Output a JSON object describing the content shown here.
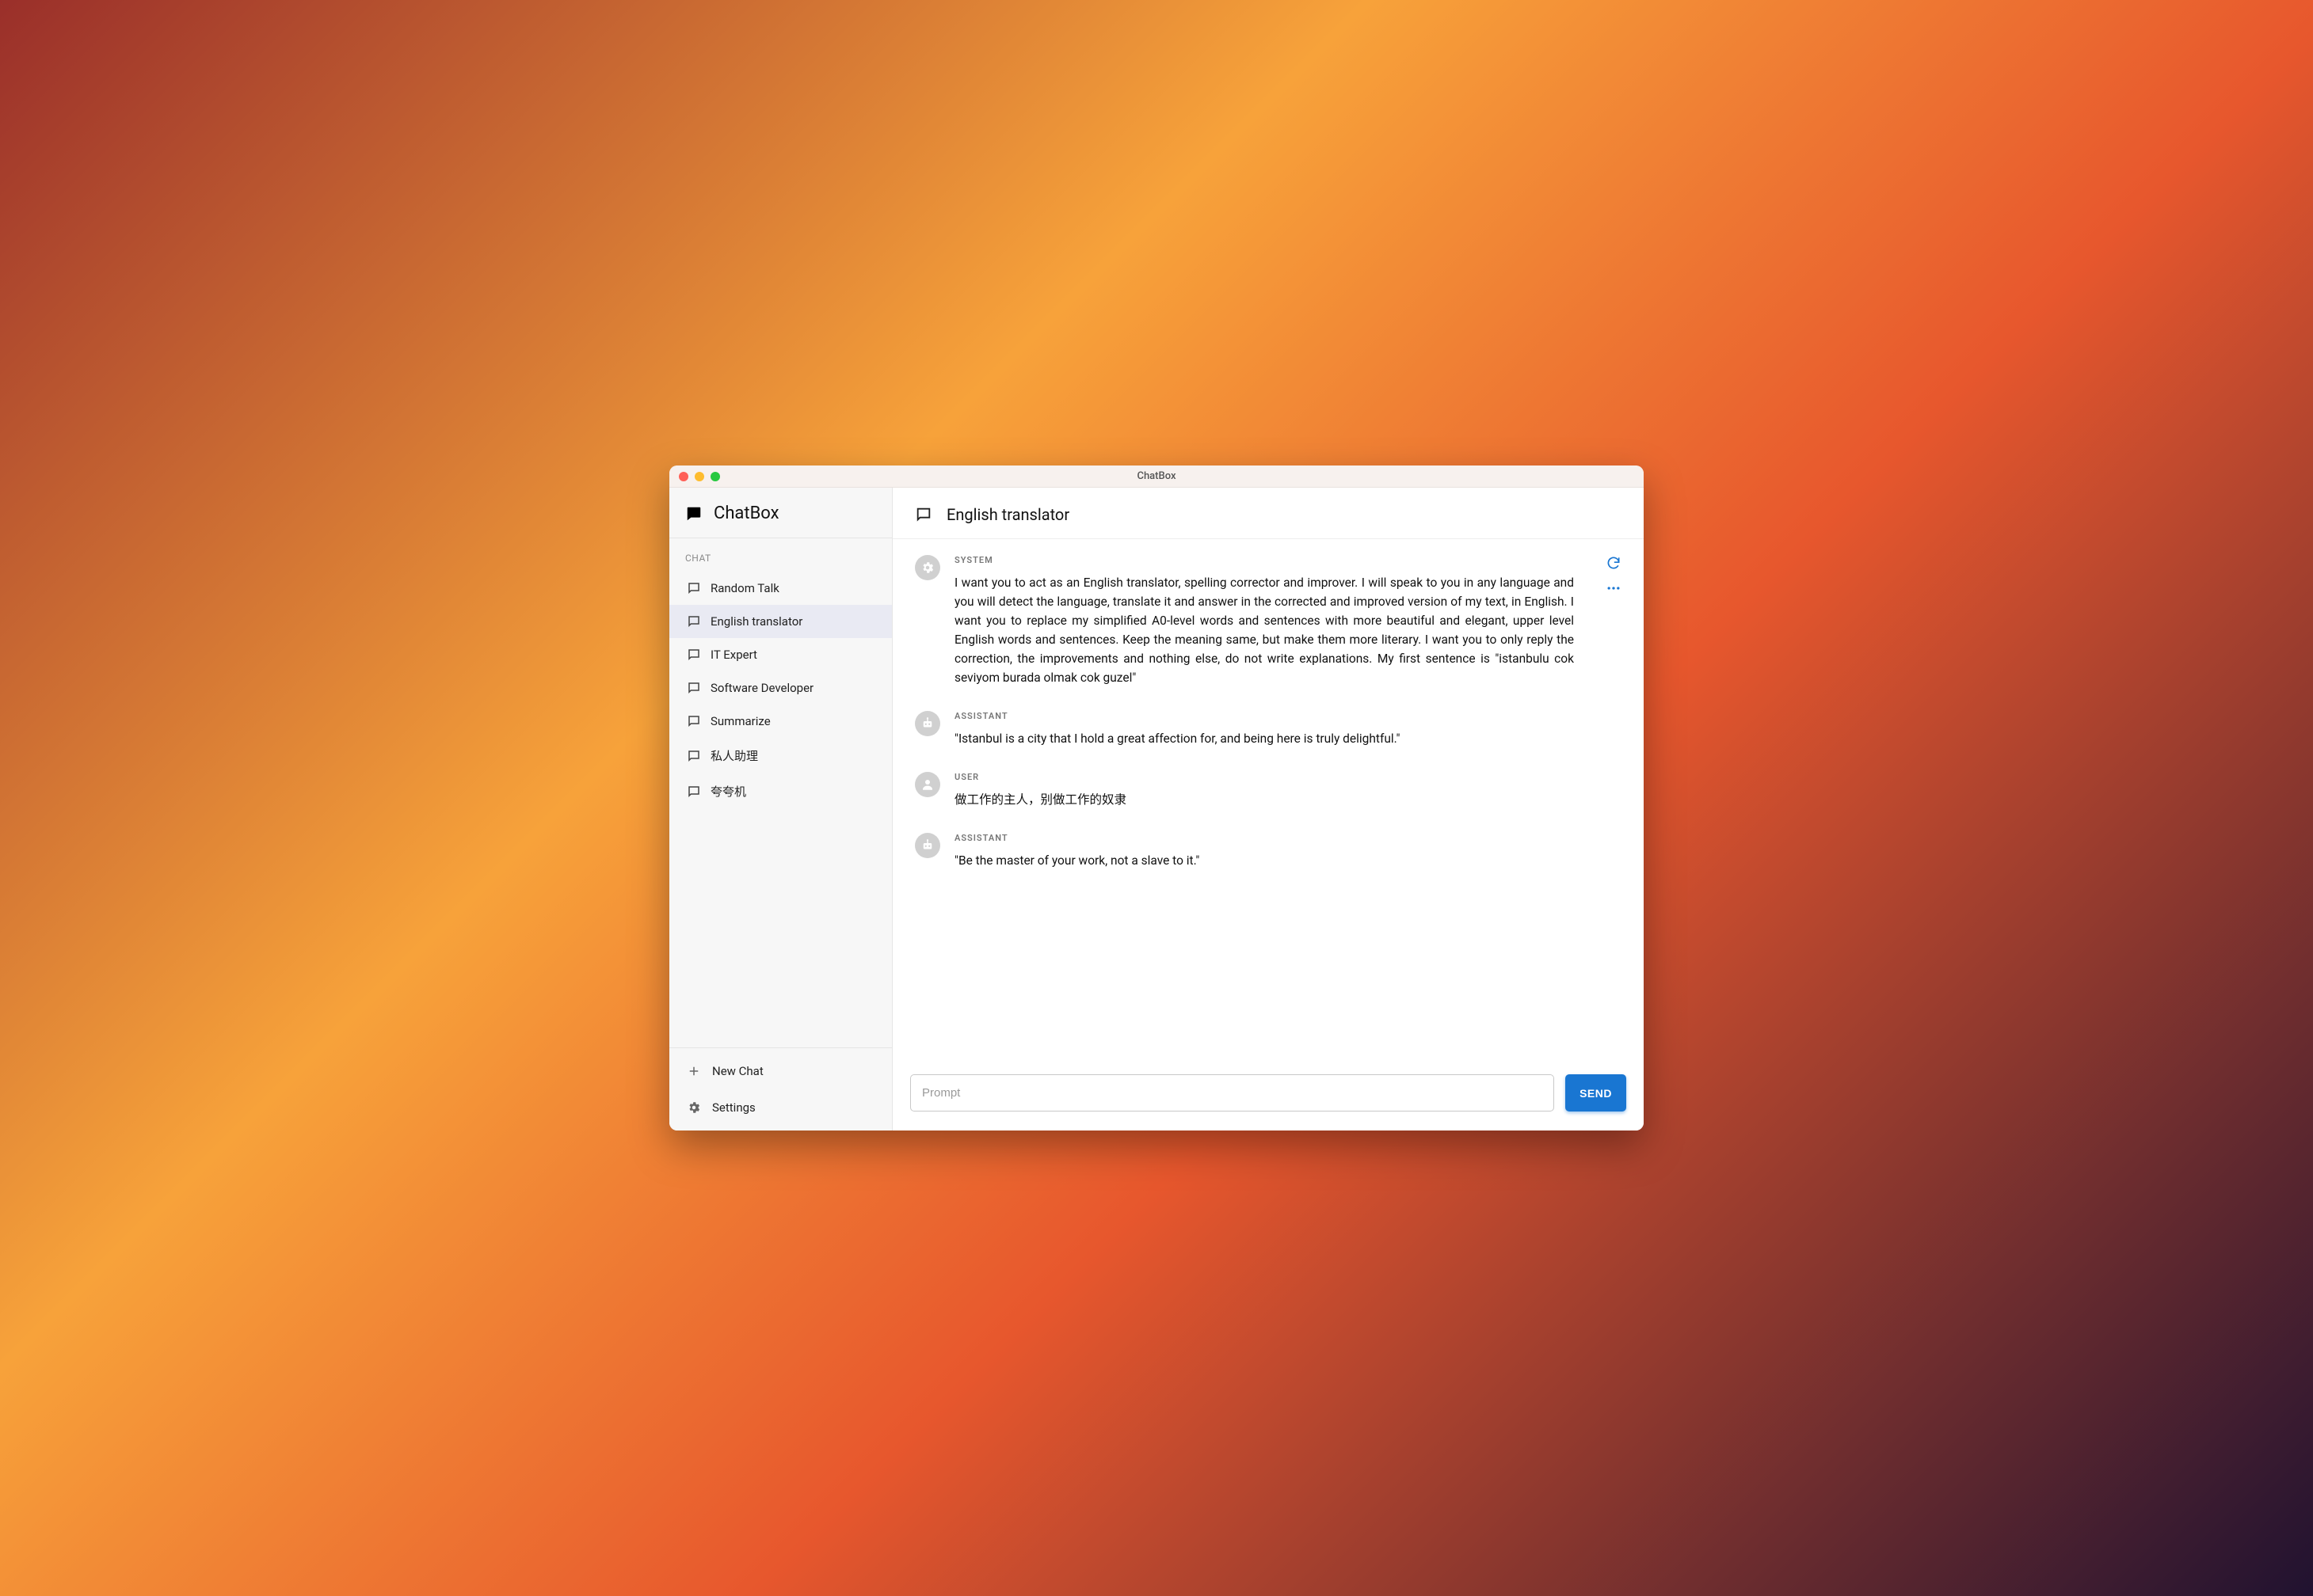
{
  "window": {
    "title": "ChatBox"
  },
  "sidebar": {
    "brand": "ChatBox",
    "section_label": "CHAT",
    "items": [
      {
        "label": "Random Talk"
      },
      {
        "label": "English translator"
      },
      {
        "label": "IT Expert"
      },
      {
        "label": "Software Developer"
      },
      {
        "label": "Summarize"
      },
      {
        "label": "私人助理"
      },
      {
        "label": "夸夸机"
      }
    ],
    "active_index": 1,
    "new_chat_label": "New Chat",
    "settings_label": "Settings"
  },
  "main": {
    "title": "English translator",
    "messages": [
      {
        "role": "SYSTEM",
        "avatar": "gear",
        "text": "I want you to act as an English translator, spelling corrector and improver. I will speak to you in any language and you will detect the language, translate it and answer in the corrected and improved version of my text, in English. I want you to replace my simplified A0-level words and sentences with more beautiful and elegant, upper level English words and sentences. Keep the meaning same, but make them more literary. I want you to only reply the correction, the improvements and nothing else, do not write explanations. My first sentence is \"istanbulu cok seviyom burada olmak cok guzel\"",
        "show_actions": true
      },
      {
        "role": "ASSISTANT",
        "avatar": "robot",
        "text": "\"Istanbul is a city that I hold a great affection for, and being here is truly delightful.\""
      },
      {
        "role": "USER",
        "avatar": "person",
        "text": "做工作的主人，别做工作的奴隶"
      },
      {
        "role": "ASSISTANT",
        "avatar": "robot",
        "text": "\"Be the master of your work, not a slave to it.\""
      }
    ],
    "composer": {
      "placeholder": "Prompt",
      "value": "",
      "send_label": "SEND"
    }
  }
}
